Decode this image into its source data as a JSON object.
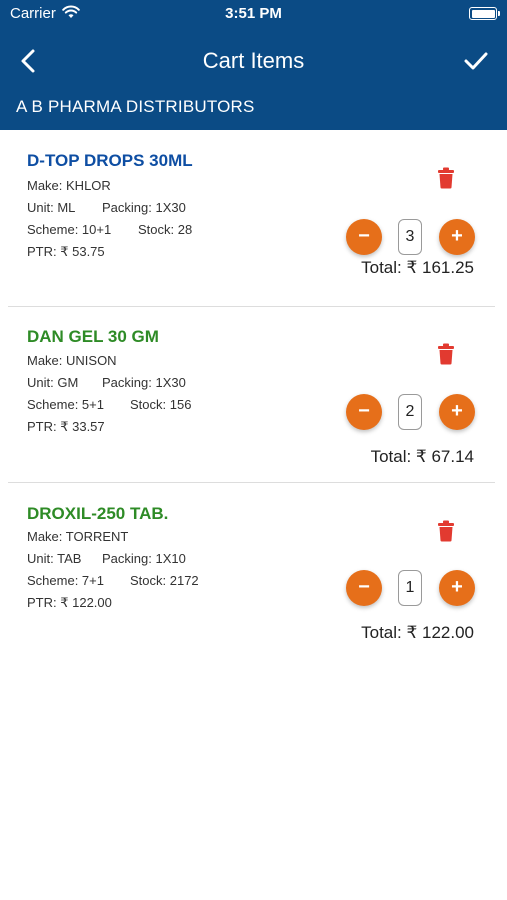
{
  "status_bar": {
    "carrier": "Carrier",
    "time": "3:51 PM"
  },
  "nav": {
    "title": "Cart Items"
  },
  "distributor": "A B PHARMA DISTRIBUTORS",
  "colors": {
    "header": "#0b4b85",
    "accent": "#e66f1a",
    "name_blue": "#0e4ea3",
    "name_green": "#2e8b26",
    "delete": "#e23a30"
  },
  "items": [
    {
      "name": "D-TOP DROPS 30ML",
      "name_color": "#0e4ea3",
      "make": "Make: KHLOR",
      "unit": "Unit: ML",
      "packing": "Packing: 1X30",
      "scheme": "Scheme: 10+1",
      "stock": "Stock: 28",
      "ptr": "PTR: ₹ 53.75",
      "qty": "3",
      "total": "Total: ₹  161.25",
      "minus": "−",
      "plus": "+"
    },
    {
      "name": "DAN GEL 30 GM",
      "name_color": "#2e8b26",
      "make": "Make: UNISON",
      "unit": "Unit: GM",
      "packing": "Packing: 1X30",
      "scheme": "Scheme: 5+1",
      "stock": "Stock: 156",
      "ptr": "PTR: ₹ 33.57",
      "qty": "2",
      "total": "Total: ₹  67.14",
      "minus": "−",
      "plus": "+"
    },
    {
      "name": "DROXIL-250 TAB.",
      "name_color": "#2e8b26",
      "make": "Make: TORRENT",
      "unit": "Unit: TAB",
      "packing": "Packing: 1X10",
      "scheme": "Scheme: 7+1",
      "stock": "Stock: 2172",
      "ptr": "PTR: ₹ 122.00",
      "qty": "1",
      "total": "Total: ₹  122.00",
      "minus": "−",
      "plus": "+"
    }
  ]
}
